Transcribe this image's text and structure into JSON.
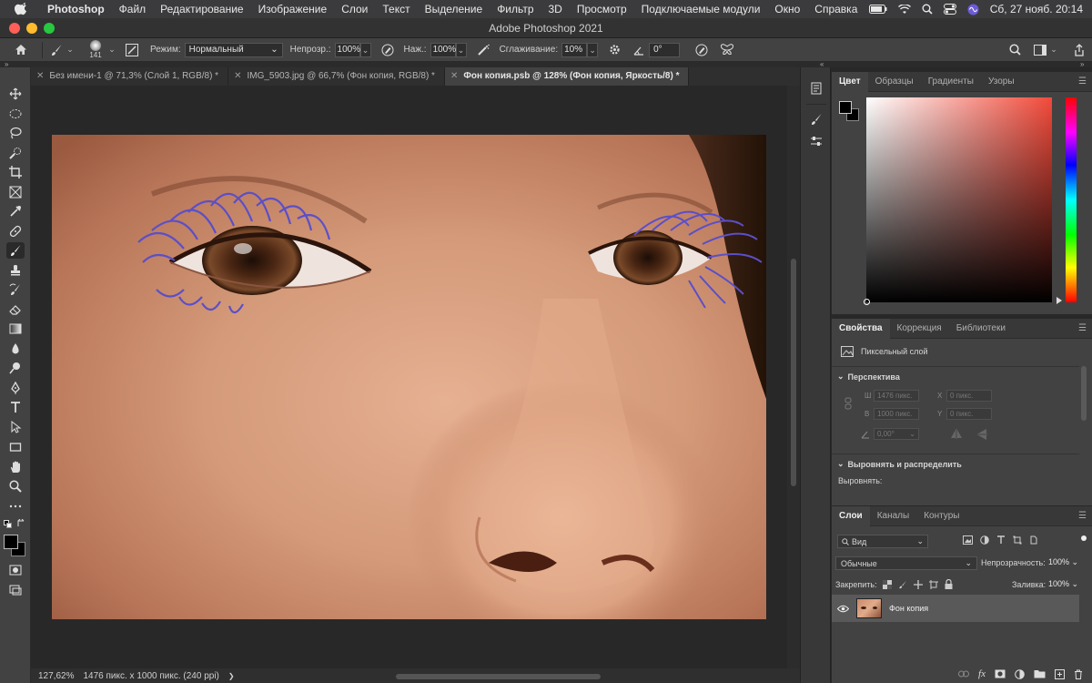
{
  "menubar": {
    "app": "Photoshop",
    "items": [
      "Файл",
      "Редактирование",
      "Изображение",
      "Слои",
      "Текст",
      "Выделение",
      "Фильтр",
      "3D",
      "Просмотр",
      "Подключаемые модули",
      "Окно",
      "Справка"
    ],
    "clock": "Сб, 27 нояб.  20:14"
  },
  "window": {
    "title": "Adobe Photoshop 2021"
  },
  "options": {
    "brush_size": "141",
    "mode_label": "Режим:",
    "mode_value": "Нормальный",
    "opacity_label": "Непрозр.:",
    "opacity_value": "100%",
    "flow_label": "Наж.:",
    "flow_value": "100%",
    "smoothing_label": "Сглаживание:",
    "smoothing_value": "10%",
    "angle_value": "0°"
  },
  "tabs": [
    {
      "label": "Без имени-1 @ 71,3% (Слой 1, RGB/8) *",
      "active": false
    },
    {
      "label": "IMG_5903.jpg @ 66,7% (Фон копия, RGB/8) *",
      "active": false
    },
    {
      "label": "Фон копия.psb @ 128% (Фон копия, Яркость/8) *",
      "active": true
    }
  ],
  "status": {
    "zoom": "127,62%",
    "info": "1476 пикс. x 1000 пикс. (240 ppi)",
    "arrow": "❯"
  },
  "color_panel": {
    "tabs": [
      "Цвет",
      "Образцы",
      "Градиенты",
      "Узоры"
    ],
    "hue_color": "#ff2a2a"
  },
  "properties_panel": {
    "tabs": [
      "Свойства",
      "Коррекция",
      "Библиотеки"
    ],
    "layer_type": "Пиксельный слой",
    "section_perspective": "Перспектива",
    "w_label": "Ш",
    "w_value": "1476 пикс.",
    "x_label": "X",
    "x_value": "0 пикс.",
    "h_label": "В",
    "h_value": "1000 пикс.",
    "y_label": "Y",
    "y_value": "0 пикс.",
    "angle_value": "0,00°",
    "section_align": "Выровнять и распределить",
    "align_label": "Выровнять:"
  },
  "layers_panel": {
    "tabs": [
      "Слои",
      "Каналы",
      "Контуры"
    ],
    "filter_value": "Вид",
    "blend_value": "Обычные",
    "opacity_label": "Непрозрачность:",
    "opacity_value": "100%",
    "lock_label": "Закрепить:",
    "fill_label": "Заливка:",
    "fill_value": "100%",
    "layers": [
      {
        "name": "Фон копия",
        "visible": true
      }
    ],
    "bottom_icons": [
      "link-icon",
      "fx",
      "mask-icon",
      "adjustment-icon",
      "folder-icon",
      "new-layer-icon",
      "trash-icon"
    ],
    "fx_label": "fx"
  }
}
